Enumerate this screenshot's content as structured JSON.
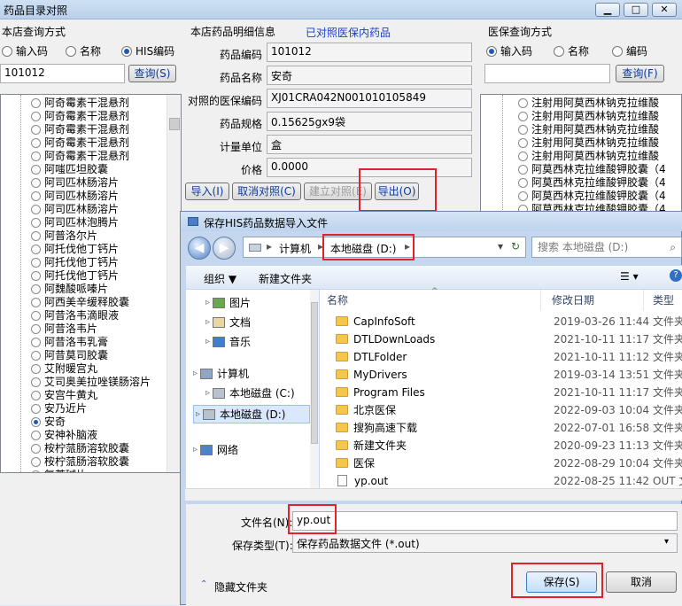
{
  "main_window": {
    "title": "药品目录对照",
    "btn_min": "▁",
    "btn_max": "□",
    "btn_close": "✕"
  },
  "store_query": {
    "group_label": "本店查询方式",
    "radio_input_code": "输入码",
    "radio_name": "名称",
    "radio_his_code": "HIS编码",
    "input_value": "101012",
    "query_button": "查询(S)",
    "list_items": [
      "阿奇霉素干混悬剂",
      "阿奇霉素干混悬剂",
      "阿奇霉素干混悬剂",
      "阿奇霉素干混悬剂",
      "阿奇霉素干混悬剂",
      "阿嗤匹坦胶囊",
      "阿司匹林肠溶片",
      "阿司匹林肠溶片",
      "阿司匹林肠溶片",
      "阿司匹林泡腾片",
      "阿普洛尔片",
      "阿托伐他丁钙片",
      "阿托伐他丁钙片",
      "阿托伐他丁钙片",
      "阿魏酸哌嗪片",
      "阿西美辛缓释胶囊",
      "阿昔洛韦滴眼液",
      "阿昔洛韦片",
      "阿昔洛韦乳膏",
      "阿昔莫司胶囊",
      "艾附暖宫丸",
      "艾司奥美拉唑镁肠溶片",
      "安宫牛黄丸",
      "安乃近片",
      "安奇",
      "安神补脑液",
      "桉柠蒎肠溶软胶囊",
      "桉柠蒎肠溶软胶囊",
      "氨茶碱片"
    ],
    "selected_index": 24
  },
  "detail": {
    "group_label": "本店药品明细信息",
    "status_link": "已对照医保内药品",
    "code_label": "药品编码",
    "code_value": "101012",
    "name_label": "药品名称",
    "name_value": "安奇",
    "insurance_code_label": "对照的医保编码",
    "insurance_code_value": "XJ01CRA042N001010105849",
    "spec_label": "药品规格",
    "spec_value": "0.15625gx9袋",
    "unit_label": "计量单位",
    "unit_value": "盒",
    "price_label": "价格",
    "price_value": "0.0000",
    "import_button": "导入(I)",
    "cancel_match_button": "取消对照(C)",
    "build_match_button": "建立对照(E)",
    "export_button": "导出(O)"
  },
  "insurance_query": {
    "group_label": "医保查询方式",
    "radio_input_code": "输入码",
    "radio_name": "名称",
    "radio_code": "编码",
    "input_value": "",
    "query_button": "查询(F)",
    "list_items": [
      "注射用阿莫西林钠克拉维酸",
      "注射用阿莫西林钠克拉维酸",
      "注射用阿莫西林钠克拉维酸",
      "注射用阿莫西林钠克拉维酸",
      "注射用阿莫西林钠克拉维酸",
      "阿莫西林克拉维酸钾胶囊（4",
      "阿莫西林克拉维酸钾胶囊（4",
      "阿莫西林克拉维酸钾胶囊（4",
      "阿莫西林克拉维酸钾胶囊（4"
    ]
  },
  "dialog": {
    "title": "保存HIS药品数据导入文件",
    "breadcrumb_1": "计算机",
    "breadcrumb_2": "本地磁盘 (D:)",
    "search_placeholder": "搜索 本地磁盘 (D:)",
    "organize": "组织 ▼",
    "new_folder": "新建文件夹",
    "nav_items": [
      {
        "label": "图片",
        "icon": "pictures-icon"
      },
      {
        "label": "文档",
        "icon": "documents-icon"
      },
      {
        "label": "音乐",
        "icon": "music-icon"
      },
      {
        "label": "计算机",
        "icon": "computer-icon"
      },
      {
        "label": "本地磁盘 (C:)",
        "icon": "drive-icon"
      },
      {
        "label": "本地磁盘 (D:)",
        "icon": "drive-icon"
      },
      {
        "label": "网络",
        "icon": "network-icon"
      }
    ],
    "col_name": "名称",
    "col_date": "修改日期",
    "col_type": "类型",
    "files": [
      {
        "name": "CapInfoSoft",
        "date": "2019-03-26 11:44",
        "type": "文件夹"
      },
      {
        "name": "DTLDownLoads",
        "date": "2021-10-11 11:17",
        "type": "文件夹"
      },
      {
        "name": "DTLFolder",
        "date": "2021-10-11 11:12",
        "type": "文件夹"
      },
      {
        "name": "MyDrivers",
        "date": "2019-03-14 13:51",
        "type": "文件夹"
      },
      {
        "name": "Program Files",
        "date": "2021-10-11 11:17",
        "type": "文件夹"
      },
      {
        "name": "北京医保",
        "date": "2022-09-03 10:04",
        "type": "文件夹"
      },
      {
        "name": "搜狗高速下载",
        "date": "2022-07-01 16:58",
        "type": "文件夹"
      },
      {
        "name": "新建文件夹",
        "date": "2020-09-23 11:13",
        "type": "文件夹"
      },
      {
        "name": "医保",
        "date": "2022-08-29 10:04",
        "type": "文件夹"
      },
      {
        "name": "yp.out",
        "date": "2022-08-25 11:42",
        "type": "OUT 文"
      }
    ],
    "filename_label": "文件名(N):",
    "filename_value": "yp.out",
    "filetype_label": "保存类型(T):",
    "filetype_value": "保存药品数据文件 (*.out)",
    "hide_folders": "隐藏文件夹",
    "save_button": "保存(S)",
    "cancel_button": "取消"
  },
  "colors": {
    "accent": "#1e5ab4",
    "highlight_red": "#e2222a",
    "link": "#1a3cc8"
  }
}
